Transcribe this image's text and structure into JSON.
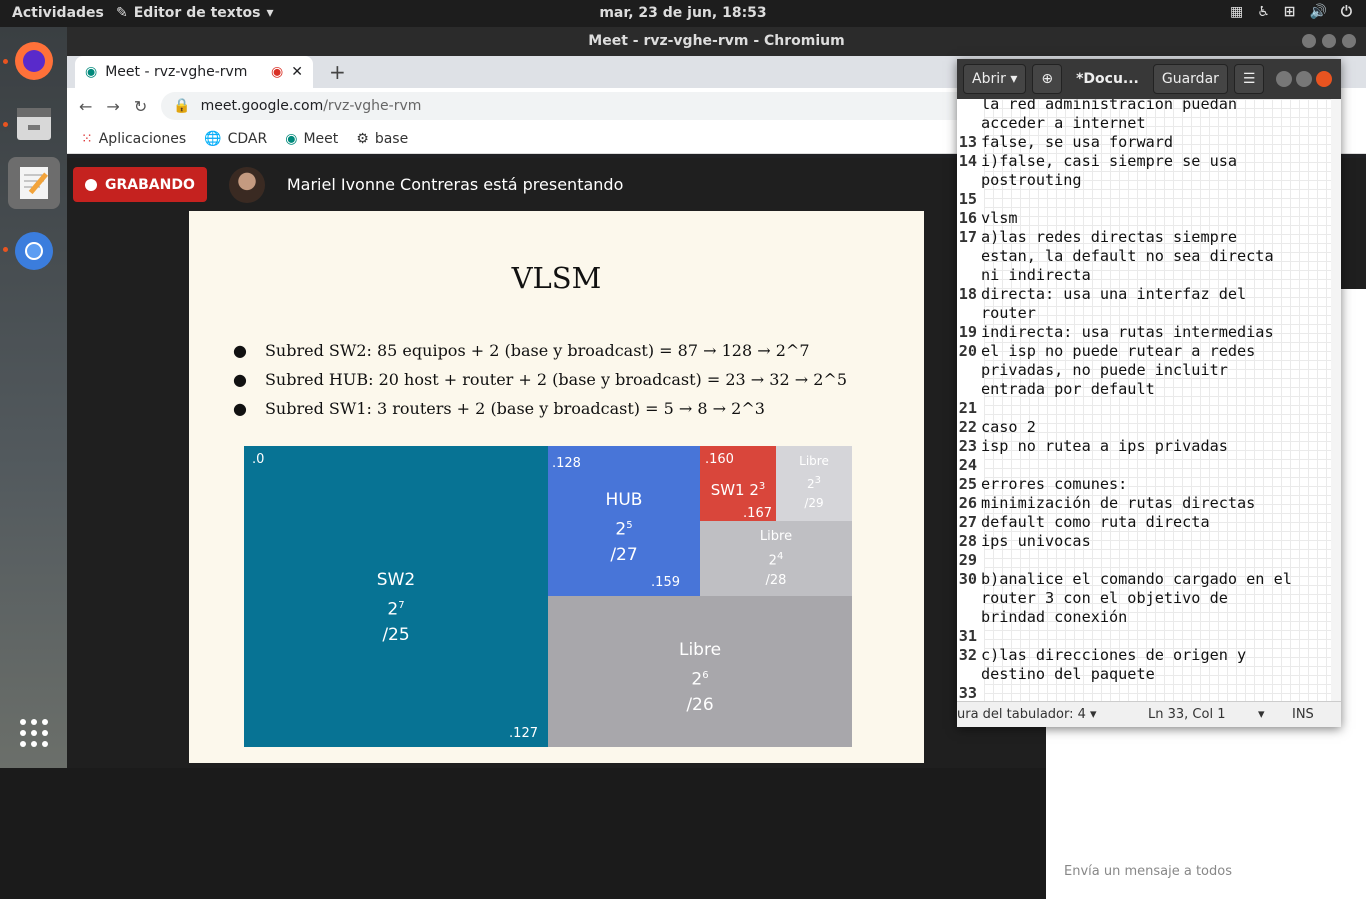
{
  "topbar": {
    "activities": "Actividades",
    "app": "Editor de textos",
    "clock": "mar, 23 de jun, 18:53"
  },
  "browser": {
    "title": "Meet - rvz-vghe-rvm - Chromium",
    "tab_title": "Meet - rvz-vghe-rvm",
    "url_host": "meet.google.com",
    "url_path": "/rvz-vghe-rvm",
    "bookmarks": [
      "Aplicaciones",
      "CDAR",
      "Meet",
      "base"
    ]
  },
  "meet": {
    "recording": "GRABANDO",
    "presenter": "Mariel Ivonne Contreras está presentando",
    "chat_placeholder": "Envía un mensaje a todos"
  },
  "slide": {
    "title": "VLSM",
    "bullets": [
      "Subred SW2: 85 equipos + 2 (base y broadcast) = 87  → 128 → 2^7",
      "Subred HUB: 20 host + router + 2 (base y broadcast) = 23 → 32 → 2^5",
      "Subred SW1: 3 routers + 2 (base y broadcast) = 5 → 8 → 2^3"
    ],
    "blocks": {
      "sw2": {
        "name": "SW2",
        "pow": "2",
        "exp": "7",
        "mask": "/25",
        "start": ".0",
        "end": ".127"
      },
      "hub": {
        "name": "HUB",
        "pow": "2",
        "exp": "5",
        "mask": "/27",
        "start": ".128",
        "end": ".159"
      },
      "sw1": {
        "name": "SW1 2",
        "exp": "3",
        "start": ".160",
        "end": ".167"
      },
      "libre29": {
        "name": "Libre",
        "pow": "2",
        "exp": "3",
        "mask": "/29"
      },
      "libre28": {
        "name": "Libre",
        "pow": "2",
        "exp": "4",
        "mask": "/28"
      },
      "libre26": {
        "name": "Libre",
        "pow": "2",
        "exp": "6",
        "mask": "/26"
      }
    }
  },
  "gedit": {
    "open": "Abrir",
    "doc": "*Docu...",
    "save": "Guardar",
    "lines": [
      {
        "n": "",
        "t": "la red administracion puedan"
      },
      {
        "n": "",
        "t": "acceder a internet"
      },
      {
        "n": "13",
        "t": "false, se usa forward"
      },
      {
        "n": "14",
        "t": "i)false, casi siempre se usa"
      },
      {
        "n": "",
        "t": "postrouting"
      },
      {
        "n": "15",
        "t": ""
      },
      {
        "n": "16",
        "t": "vlsm"
      },
      {
        "n": "17",
        "t": "a)las redes directas siempre"
      },
      {
        "n": "",
        "t": "estan, la default no sea directa"
      },
      {
        "n": "",
        "t": "ni indirecta"
      },
      {
        "n": "18",
        "t": "directa: usa una interfaz del"
      },
      {
        "n": "",
        "t": "router"
      },
      {
        "n": "19",
        "t": "indirecta: usa rutas intermedias"
      },
      {
        "n": "20",
        "t": "el isp no puede rutear a redes"
      },
      {
        "n": "",
        "t": "privadas, no puede incluitr"
      },
      {
        "n": "",
        "t": "entrada por default"
      },
      {
        "n": "21",
        "t": ""
      },
      {
        "n": "22",
        "t": "caso 2"
      },
      {
        "n": "23",
        "t": "isp no rutea a ips privadas"
      },
      {
        "n": "24",
        "t": ""
      },
      {
        "n": "25",
        "t": "errores comunes:"
      },
      {
        "n": "26",
        "t": "minimización de rutas directas"
      },
      {
        "n": "27",
        "t": "default como ruta directa"
      },
      {
        "n": "28",
        "t": "ips univocas"
      },
      {
        "n": "29",
        "t": ""
      },
      {
        "n": "30",
        "t": "b)analice el comando cargado en el"
      },
      {
        "n": "",
        "t": "router 3 con el objetivo de"
      },
      {
        "n": "",
        "t": "brindad conexión"
      },
      {
        "n": "31",
        "t": ""
      },
      {
        "n": "32",
        "t": "c)las direcciones de origen y"
      },
      {
        "n": "",
        "t": "destino del paquete"
      },
      {
        "n": "33",
        "t": ""
      }
    ],
    "status_tab": "ura del tabulador: 4",
    "status_pos": "Ln 33, Col 1",
    "status_ins": "INS"
  }
}
